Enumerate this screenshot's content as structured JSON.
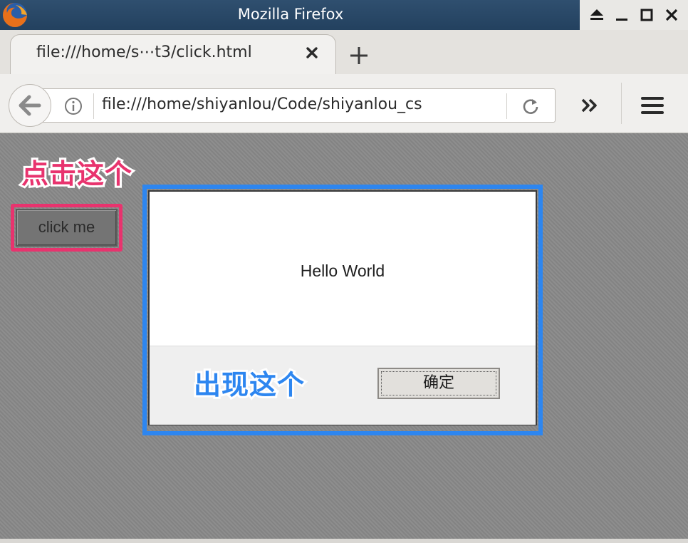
{
  "window": {
    "title": "Mozilla Firefox",
    "logo_icon": "firefox-logo-icon",
    "buttons": [
      "eject-icon",
      "minimize-icon",
      "maximize-icon",
      "close-icon"
    ]
  },
  "tabs": [
    {
      "title": "file:///home/s⋯t3/click.html",
      "close_icon": "close-tab-icon",
      "active": true
    }
  ],
  "new_tab_icon": "plus-icon",
  "navbar": {
    "back_icon": "back-arrow-icon",
    "info_icon": "info-icon",
    "url": "file:///home/shiyanlou/Code/shiyanlou_cs",
    "reload_icon": "reload-icon",
    "overflow_icon": "chevron-double-right-icon",
    "menu_icon": "hamburger-menu-icon"
  },
  "page": {
    "annotation_click": "点击这个",
    "click_button_label": "click me",
    "annotation_appear": "出现这个",
    "alert": {
      "message": "Hello World",
      "ok_label": "确定"
    }
  },
  "colors": {
    "annotation_pink": "#e8336e",
    "annotation_blue": "#2d86f0",
    "titlebar": "#2f4f6f",
    "content_bg": "#888888"
  }
}
